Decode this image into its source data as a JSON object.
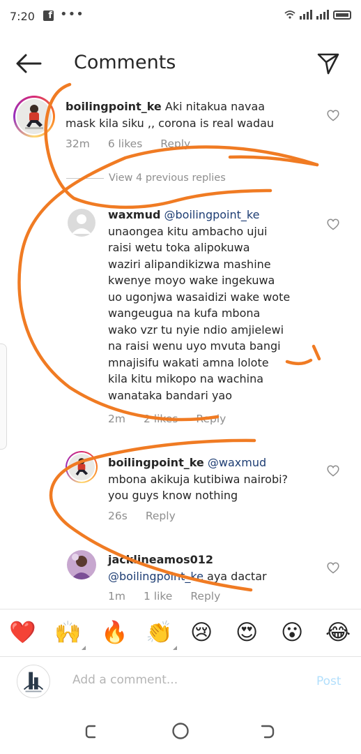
{
  "status_bar": {
    "time": "7:20",
    "fb_glyph": "f",
    "dots": "•••"
  },
  "header": {
    "title": "Comments"
  },
  "main_comment": {
    "username": "boilingpoint_ke",
    "text_line1": "Aki nitakua navaa",
    "text_line2": "mask kila siku ,, corona is real wadau",
    "time": "32m",
    "likes": "6 likes",
    "reply": "Reply"
  },
  "view_previous": "View 4 previous replies",
  "replies": [
    {
      "username": "waxmud",
      "mention": "@boilingpoint_ke",
      "lines": [
        "unaongea kitu ambacho ujui",
        "raisi wetu toka alipokuwa",
        "waziri alipandikizwa mashine",
        "kwenye moyo wake ingekuwa",
        "uo ugonjwa wasaidizi wake wote",
        "wangeugua na kufa mbona",
        "wako vzr tu nyie ndio amjielewi",
        "na raisi wenu uyo mvuta bangi",
        "mnajisifu wakati amna lolote",
        "kila kitu mikopo na wachina",
        "wanataka bandari yao"
      ],
      "time": "2m",
      "likes": "2 likes",
      "reply": "Reply"
    },
    {
      "username": "boilingpoint_ke",
      "mention": "@waxmud",
      "lines": [
        "mbona akikuja kutibiwa nairobi?",
        "you guys know nothing"
      ],
      "time": "26s",
      "reply": "Reply"
    },
    {
      "username": "jacklineamos012",
      "mention": "@boilingpoint_ke",
      "text_after": " aya dactar",
      "time": "1m",
      "likes": "1 like",
      "reply": "Reply"
    }
  ],
  "emoji_bar": [
    "❤️",
    "🙌",
    "🔥",
    "👏",
    "😢",
    "😍",
    "😮",
    "😂"
  ],
  "input": {
    "placeholder": "Add a comment...",
    "post": "Post"
  },
  "colors": {
    "mention": "#1d3d73",
    "overlay": "#f07b23",
    "post_disabled": "#b2dffc"
  }
}
